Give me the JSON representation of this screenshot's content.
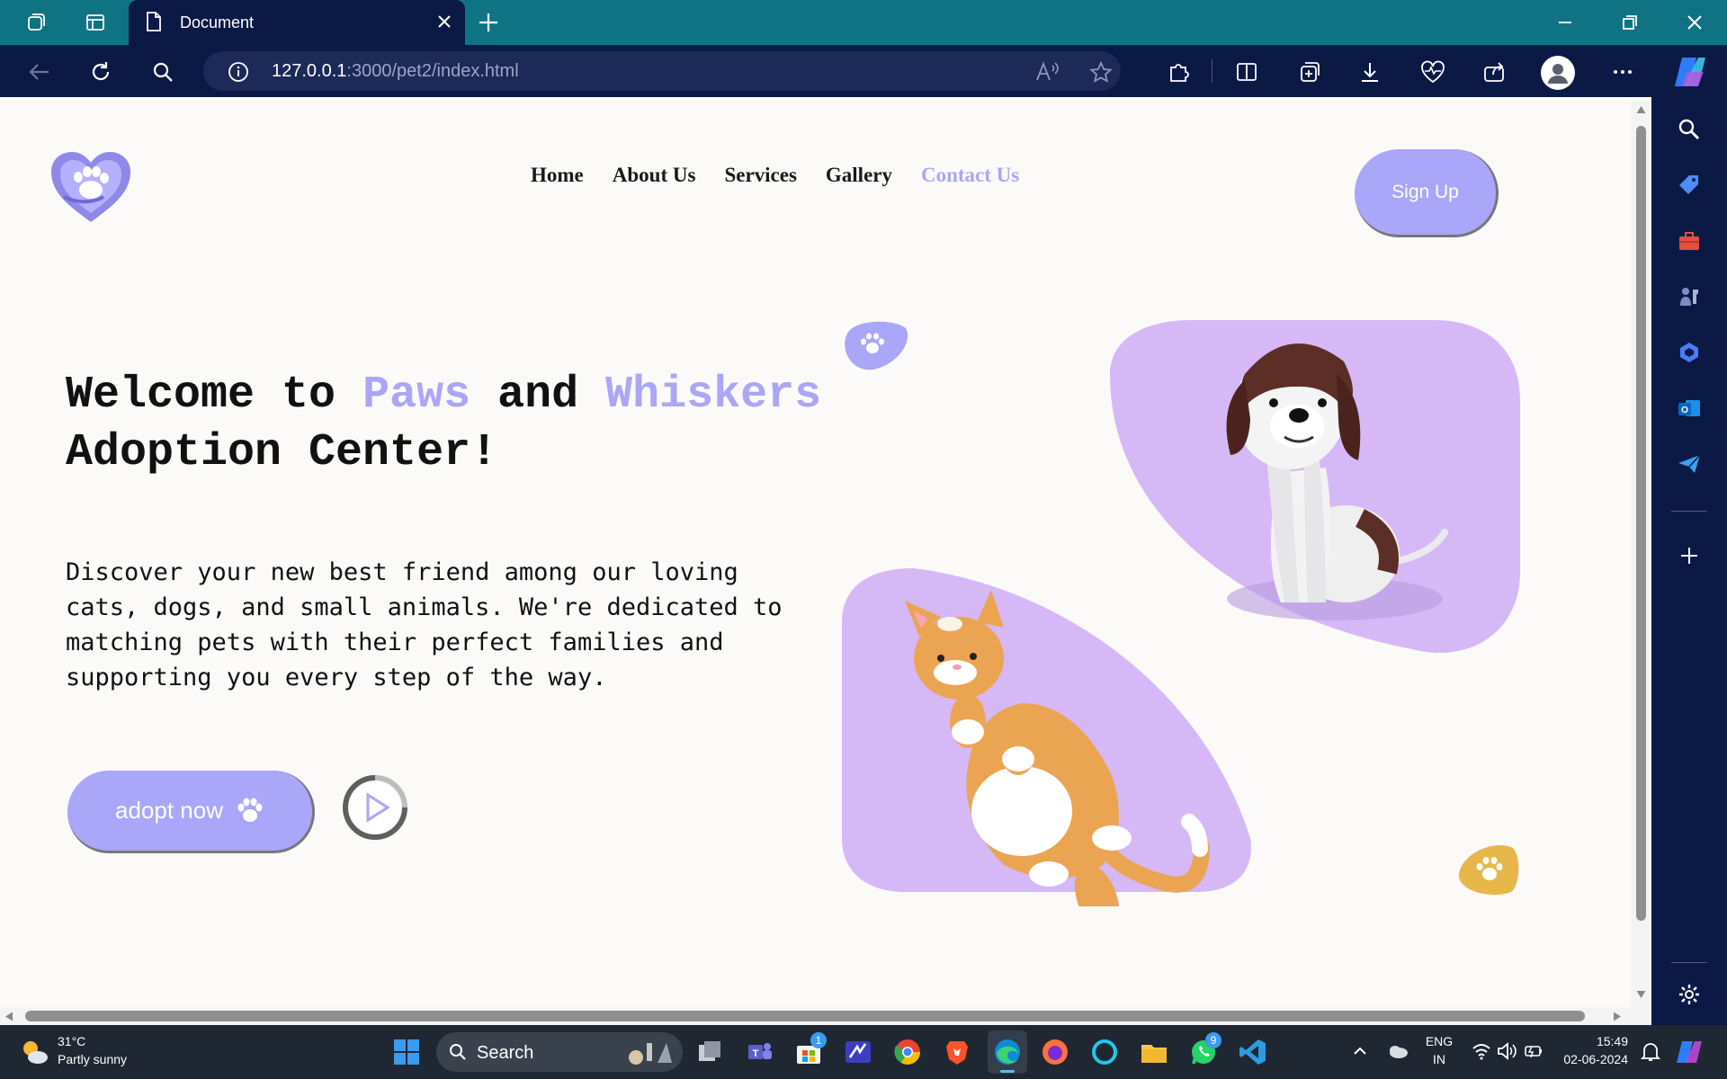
{
  "browser": {
    "tab_title": "Document",
    "url_host": "127.0.0.1",
    "url_rest": ":3000/pet2/index.html"
  },
  "site": {
    "nav": [
      "Home",
      "About Us",
      "Services",
      "Gallery",
      "Contact Us"
    ],
    "signup_label": "Sign Up",
    "hero_title": {
      "part1": "Welcome to ",
      "accent1": "Paws",
      "part2": " and ",
      "accent2": "Whiskers",
      "part3": "Adoption Center!"
    },
    "hero_text": "Discover your new best friend among our loving cats, dogs, and small animals. We're dedicated to matching pets with their perfect families and supporting you every step of the way.",
    "adopt_label": "adopt now",
    "accent_color": "#aba6f6",
    "blob_color": "#d6b8f7",
    "paw_yellow": "#e8b74a"
  },
  "taskbar": {
    "weather_temp": "31°C",
    "weather_desc": "Partly sunny",
    "search_label": "Search",
    "lang_top": "ENG",
    "lang_bottom": "IN",
    "time": "15:49",
    "date": "02-06-2024",
    "store_badge": "1",
    "whatsapp_badge": "9"
  }
}
